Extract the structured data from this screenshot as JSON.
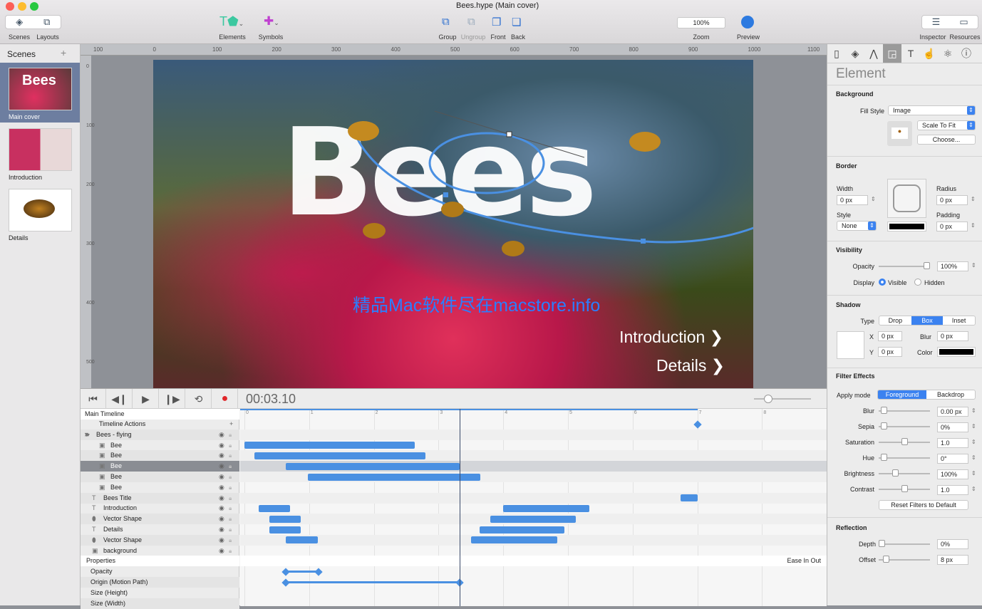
{
  "window": {
    "title": "Bees.hype (Main cover)"
  },
  "toolbar": {
    "scenes": "Scenes",
    "layouts": "Layouts",
    "elements": "Elements",
    "symbols": "Symbols",
    "group": "Group",
    "ungroup": "Ungroup",
    "front": "Front",
    "back": "Back",
    "zoom_value": "100%",
    "zoom": "Zoom",
    "preview": "Preview",
    "inspector": "Inspector",
    "resources": "Resources"
  },
  "sidebar": {
    "title": "Scenes",
    "add": "+",
    "scenes": [
      {
        "label": "Main cover",
        "thumb_text": "Bees"
      },
      {
        "label": "Introduction"
      },
      {
        "label": "Details"
      }
    ]
  },
  "ruler": {
    "top": [
      "100",
      "0",
      "100",
      "200",
      "300",
      "400",
      "500",
      "600",
      "700",
      "800",
      "900",
      "1000",
      "1100"
    ],
    "left": [
      "0",
      "100",
      "200",
      "300",
      "400",
      "500"
    ]
  },
  "stage": {
    "title": "Bees",
    "link1": "Introduction",
    "link2": "Details",
    "watermark": "精品Mac软件尽在macstore.info"
  },
  "timeline": {
    "time": "00:03.10",
    "playhead": 3.33,
    "timeline_name": "Main Timeline",
    "ticks": [
      "0",
      "1",
      "2",
      "3",
      "4",
      "5",
      "6",
      "7",
      "8"
    ],
    "properties": "Properties",
    "easing": "Ease In Out",
    "rows": [
      {
        "label": "Timeline Actions",
        "indent": 1,
        "icon": "",
        "bars": [],
        "kf": [
          7.0
        ]
      },
      {
        "label": "Bees - flying",
        "indent": 0,
        "icon": "folder",
        "bars": []
      },
      {
        "label": "Bee",
        "indent": 2,
        "icon": "image",
        "bars": [
          [
            0,
            2.63
          ]
        ]
      },
      {
        "label": "Bee",
        "indent": 2,
        "icon": "image",
        "bars": [
          [
            0.15,
            2.8
          ]
        ]
      },
      {
        "label": "Bee",
        "indent": 2,
        "icon": "image",
        "bars": [
          [
            0.64,
            3.33
          ]
        ],
        "selected": true
      },
      {
        "label": "Bee",
        "indent": 2,
        "icon": "image",
        "bars": [
          [
            0.98,
            3.65
          ]
        ]
      },
      {
        "label": "Bee",
        "indent": 2,
        "icon": "image",
        "bars": []
      },
      {
        "label": "Bees Title",
        "indent": 1,
        "icon": "text",
        "bars": [
          [
            6.74,
            7.0
          ]
        ]
      },
      {
        "label": "Introduction",
        "indent": 1,
        "icon": "text",
        "bars": [
          [
            0.22,
            0.71
          ],
          [
            4.0,
            5.33
          ]
        ]
      },
      {
        "label": "Vector Shape",
        "indent": 1,
        "icon": "shape",
        "bars": [
          [
            0.38,
            0.87
          ],
          [
            3.8,
            5.12
          ]
        ]
      },
      {
        "label": "Details",
        "indent": 1,
        "icon": "text",
        "bars": [
          [
            0.38,
            0.87
          ],
          [
            3.63,
            4.95
          ]
        ]
      },
      {
        "label": "Vector Shape",
        "indent": 1,
        "icon": "shape",
        "bars": [
          [
            0.64,
            1.13
          ],
          [
            3.5,
            4.83
          ]
        ]
      },
      {
        "label": "background",
        "indent": 1,
        "icon": "image",
        "bars": []
      }
    ],
    "props": [
      {
        "label": "Opacity",
        "kf": [
          0.64,
          1.15
        ]
      },
      {
        "label": "Origin (Motion Path)",
        "kf": [
          0.64,
          3.33
        ]
      },
      {
        "label": "Size (Height)",
        "kf": []
      },
      {
        "label": "Size (Width)",
        "kf": []
      }
    ]
  },
  "inspector": {
    "title": "Element",
    "background": "Background",
    "fill_style": "Fill Style",
    "fill_value": "Image",
    "scale": "Scale To Fit",
    "choose": "Choose...",
    "border": "Border",
    "width": "Width",
    "width_v": "0 px",
    "radius": "Radius",
    "radius_v": "0 px",
    "style": "Style",
    "style_v": "None",
    "padding": "Padding",
    "padding_v": "0 px",
    "visibility": "Visibility",
    "opacity": "Opacity",
    "opacity_v": "100%",
    "opacity_level": 1.0,
    "display": "Display",
    "visible": "Visible",
    "hidden": "Hidden",
    "shadow": "Shadow",
    "type": "Type",
    "drop": "Drop",
    "box": "Box",
    "inset": "Inset",
    "x": "X",
    "x_v": "0 px",
    "y": "Y",
    "y_v": "0 px",
    "blur": "Blur",
    "blur_v": "0 px",
    "color": "Color",
    "filters": "Filter Effects",
    "apply_mode": "Apply mode",
    "foreground": "Foreground",
    "backdrop": "Backdrop",
    "filter_rows": [
      {
        "label": "Blur",
        "value": "0.00 px"
      },
      {
        "label": "Sepia",
        "value": "0%"
      },
      {
        "label": "Saturation",
        "value": "1.0"
      },
      {
        "label": "Hue",
        "value": "0°"
      },
      {
        "label": "Brightness",
        "value": "100%"
      },
      {
        "label": "Contrast",
        "value": "1.0"
      }
    ],
    "reset": "Reset Filters to Default",
    "reflection": "Reflection",
    "depth": "Depth",
    "depth_v": "0%",
    "offset": "Offset",
    "offset_v": "8 px"
  },
  "colors": {
    "accent": "#4a90e2",
    "record": "#e0262a"
  }
}
